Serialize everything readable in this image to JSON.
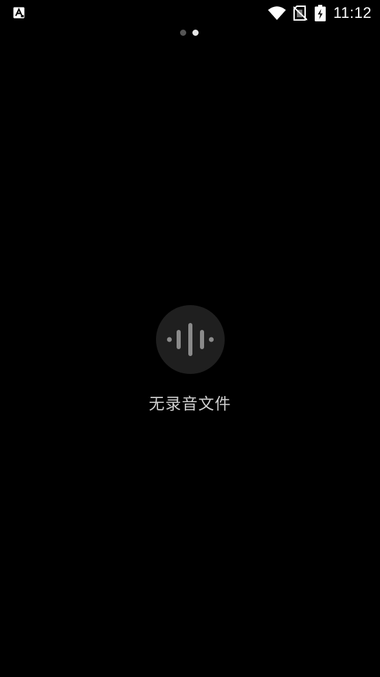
{
  "status_bar": {
    "time": "11:12",
    "icons": [
      "notification-app-icon",
      "wifi-icon",
      "no-sim-icon",
      "battery-charging-icon"
    ]
  },
  "pager": {
    "page_count": 2,
    "active_index": 1
  },
  "empty_state": {
    "icon": "waveform-icon",
    "message": "无录音文件"
  },
  "colors": {
    "background": "#000000",
    "icon_circle": "#1f1f1f",
    "icon_bars": "#8a8a8a",
    "text": "#cfcfcf"
  }
}
